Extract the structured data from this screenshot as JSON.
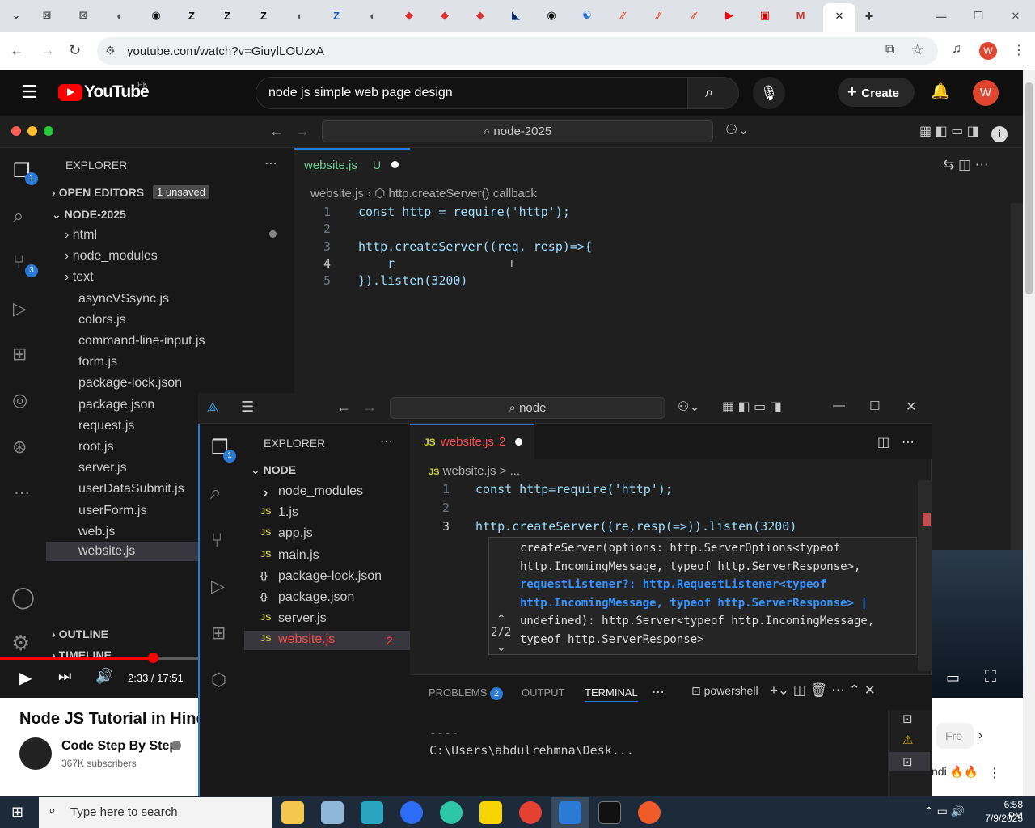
{
  "browser": {
    "url": "youtube.com/watch?v=GiuylLOUzxA",
    "tab_icons": [
      "Z",
      "Z",
      "Z",
      "Z"
    ],
    "profile_initial": "W"
  },
  "youtube": {
    "logo": "YouTube",
    "region": "PK",
    "search": "node js simple web page design",
    "create": "Create",
    "avatar": "W",
    "video_title": "Node JS Tutorial in Hindi",
    "channel": "Code Step By Step",
    "subs": "367K subscribers",
    "time": "2:33 / 17:51",
    "side_text": "Fro",
    "side_text2": "ndi 🔥🔥"
  },
  "vs1": {
    "search": "node-2025",
    "explorer": "EXPLORER",
    "open_editors": "OPEN EDITORS",
    "unsaved": "1 unsaved",
    "folder": "NODE-2025",
    "tree": [
      "html",
      "node_modules",
      "text",
      "asyncVSsync.js",
      "colors.js",
      "command-line-input.js",
      "form.js",
      "package-lock.json",
      "package.json",
      "request.js",
      "root.js",
      "server.js",
      "userDataSubmit.js",
      "userForm.js",
      "web.js",
      "website.js"
    ],
    "outline": "OUTLINE",
    "timeline": "TIMELINE",
    "tab": "website.js",
    "tab_status": "U",
    "breadcrumb_file": "website.js",
    "breadcrumb_sym": "http.createServer() callback",
    "lines": [
      {
        "n": "1",
        "t": "const http = require('http');"
      },
      {
        "n": "2",
        "t": ""
      },
      {
        "n": "3",
        "t": "http.createServer((req, resp)=>{"
      },
      {
        "n": "4",
        "t": "    r"
      },
      {
        "n": "5",
        "t": "}).listen(3200)"
      }
    ]
  },
  "vs2": {
    "search": "node",
    "explorer": "EXPLORER",
    "folder": "NODE",
    "tree": [
      {
        "i": "›",
        "t": "node_modules"
      },
      {
        "i": "JS",
        "t": "1.js"
      },
      {
        "i": "JS",
        "t": "app.js"
      },
      {
        "i": "JS",
        "t": "main.js"
      },
      {
        "i": "{}",
        "t": "package-lock.json"
      },
      {
        "i": "{}",
        "t": "package.json"
      },
      {
        "i": "JS",
        "t": "server.js"
      },
      {
        "i": "JS",
        "t": "website.js"
      }
    ],
    "website_badge": "2",
    "tab": "website.js",
    "tab_badge": "2",
    "breadcrumb": "website.js > ...",
    "lines": [
      {
        "n": "1",
        "t": "const http=require('http');"
      },
      {
        "n": "2",
        "t": ""
      },
      {
        "n": "3",
        "t": "http.createServer((re,resp(=>)).listen(3200)"
      }
    ],
    "hint": [
      "createServer(options: http.ServerOptions<typeof",
      "http.IncomingMessage, typeof http.ServerResponse>,",
      "requestListener?: http.RequestListener<typeof",
      "http.IncomingMessage, typeof http.ServerResponse> |",
      "undefined): http.Server<typeof http.IncomingMessage,",
      "typeof http.ServerResponse>"
    ],
    "hint_page": "2/2",
    "panel_tabs": {
      "problems": "PROBLEMS",
      "problems_count": "2",
      "output": "OUTPUT",
      "terminal": "TERMINAL"
    },
    "shell": "powershell",
    "term": [
      "----",
      "C:\\Users\\abdulrehmna\\Desk..."
    ]
  },
  "taskbar": {
    "search": "Type here to search",
    "time": "6:58 PM",
    "date": "7/9/2025"
  }
}
